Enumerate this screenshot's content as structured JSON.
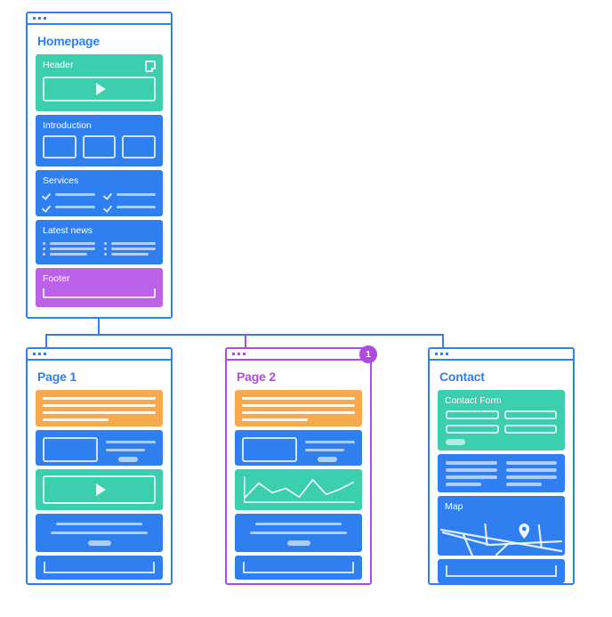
{
  "diagram": {
    "type": "sitemap-wireframe",
    "accent_blue": "#2f7ff0",
    "accent_purple": "#b14ae0",
    "teal": "#3ccfaf",
    "orange": "#f7a94b",
    "purple_block": "#bb62e8"
  },
  "cards": {
    "homepage": {
      "title": "Homepage",
      "sections": [
        {
          "label": "Header",
          "color": "teal",
          "icon": "document-icon",
          "content": "play-hero"
        },
        {
          "label": "Introduction",
          "color": "blue",
          "content": "three-squares"
        },
        {
          "label": "Services",
          "color": "blue",
          "content": "checklist-two-columns"
        },
        {
          "label": "Latest news",
          "color": "blue",
          "content": "bulleted-list-two-columns"
        },
        {
          "label": "Footer",
          "color": "purple",
          "content": "footer-bar"
        }
      ]
    },
    "page1": {
      "title": "Page 1",
      "sections": [
        {
          "label": "",
          "color": "orange",
          "content": "text-lines"
        },
        {
          "label": "",
          "color": "blue",
          "content": "media-and-text"
        },
        {
          "label": "",
          "color": "teal",
          "content": "video-player"
        },
        {
          "label": "",
          "color": "blue",
          "content": "centered-text"
        },
        {
          "label": "",
          "color": "blue",
          "content": "footer-bar"
        }
      ]
    },
    "page2": {
      "title": "Page 2",
      "badge": "1",
      "sections": [
        {
          "label": "",
          "color": "orange",
          "content": "text-lines"
        },
        {
          "label": "",
          "color": "blue",
          "content": "media-and-text"
        },
        {
          "label": "",
          "color": "teal",
          "content": "line-chart"
        },
        {
          "label": "",
          "color": "blue",
          "content": "centered-text"
        },
        {
          "label": "",
          "color": "blue",
          "content": "footer-bar"
        }
      ]
    },
    "contact": {
      "title": "Contact",
      "sections": [
        {
          "label": "Contact Form",
          "color": "teal",
          "content": "form-fields"
        },
        {
          "label": "",
          "color": "blue",
          "content": "two-column-lines"
        },
        {
          "label": "Map",
          "color": "blue",
          "content": "map-with-pin"
        },
        {
          "label": "",
          "color": "blue",
          "content": "footer-bar"
        }
      ]
    }
  },
  "chart_data": {
    "type": "line",
    "title": "",
    "x": [
      0,
      1,
      2,
      3,
      4,
      5,
      6,
      7,
      8
    ],
    "values": [
      18,
      40,
      26,
      34,
      20,
      46,
      24,
      33,
      41
    ],
    "xlabel": "",
    "ylabel": "",
    "ylim": [
      0,
      50
    ],
    "grid": false,
    "legend": "none"
  }
}
